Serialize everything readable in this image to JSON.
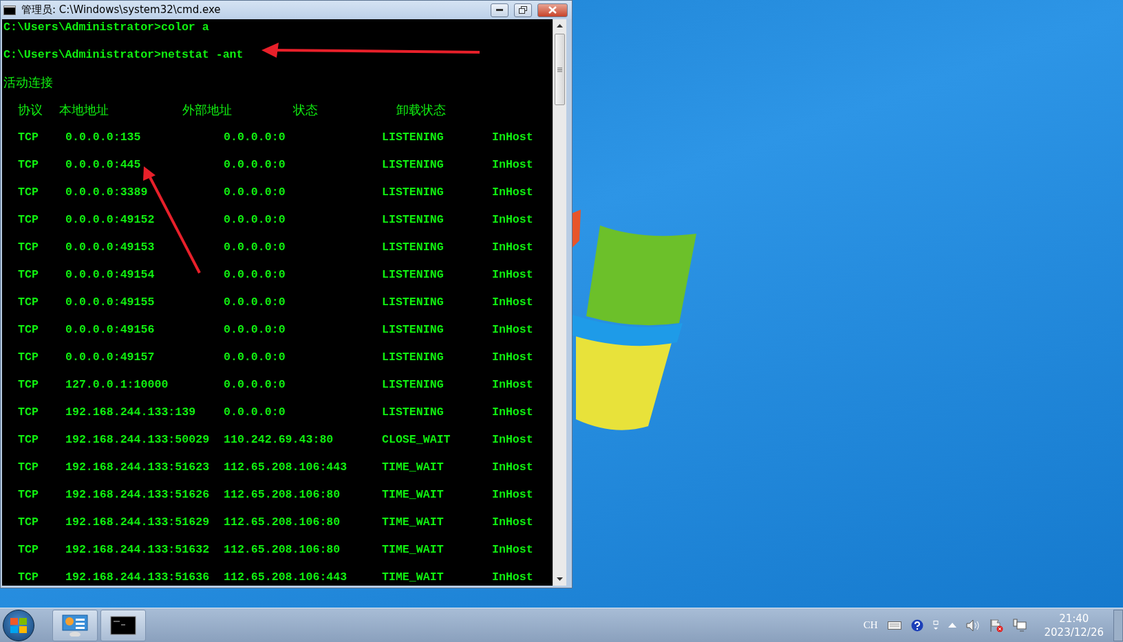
{
  "window": {
    "title": "管理员: C:\\Windows\\system32\\cmd.exe"
  },
  "console": {
    "commands": [
      "C:\\Users\\Administrator>color a",
      "C:\\Users\\Administrator>netstat -ant"
    ],
    "section_title": "活动连接",
    "columns": [
      "协议",
      "本地地址",
      "外部地址",
      "状态",
      "卸载状态"
    ],
    "rows": [
      {
        "protocol": "TCP",
        "local": "0.0.0.0:135",
        "foreign": "0.0.0.0:0",
        "state": "LISTENING",
        "offload": "InHost"
      },
      {
        "protocol": "TCP",
        "local": "0.0.0.0:445",
        "foreign": "0.0.0.0:0",
        "state": "LISTENING",
        "offload": "InHost"
      },
      {
        "protocol": "TCP",
        "local": "0.0.0.0:3389",
        "foreign": "0.0.0.0:0",
        "state": "LISTENING",
        "offload": "InHost"
      },
      {
        "protocol": "TCP",
        "local": "0.0.0.0:49152",
        "foreign": "0.0.0.0:0",
        "state": "LISTENING",
        "offload": "InHost"
      },
      {
        "protocol": "TCP",
        "local": "0.0.0.0:49153",
        "foreign": "0.0.0.0:0",
        "state": "LISTENING",
        "offload": "InHost"
      },
      {
        "protocol": "TCP",
        "local": "0.0.0.0:49154",
        "foreign": "0.0.0.0:0",
        "state": "LISTENING",
        "offload": "InHost"
      },
      {
        "protocol": "TCP",
        "local": "0.0.0.0:49155",
        "foreign": "0.0.0.0:0",
        "state": "LISTENING",
        "offload": "InHost"
      },
      {
        "protocol": "TCP",
        "local": "0.0.0.0:49156",
        "foreign": "0.0.0.0:0",
        "state": "LISTENING",
        "offload": "InHost"
      },
      {
        "protocol": "TCP",
        "local": "0.0.0.0:49157",
        "foreign": "0.0.0.0:0",
        "state": "LISTENING",
        "offload": "InHost"
      },
      {
        "protocol": "TCP",
        "local": "127.0.0.1:10000",
        "foreign": "0.0.0.0:0",
        "state": "LISTENING",
        "offload": "InHost"
      },
      {
        "protocol": "TCP",
        "local": "192.168.244.133:139",
        "foreign": "0.0.0.0:0",
        "state": "LISTENING",
        "offload": "InHost"
      },
      {
        "protocol": "TCP",
        "local": "192.168.244.133:50029",
        "foreign": "110.242.69.43:80",
        "state": "CLOSE_WAIT",
        "offload": "InHost"
      },
      {
        "protocol": "TCP",
        "local": "192.168.244.133:51623",
        "foreign": "112.65.208.106:443",
        "state": "TIME_WAIT",
        "offload": "InHost"
      },
      {
        "protocol": "TCP",
        "local": "192.168.244.133:51626",
        "foreign": "112.65.208.106:80",
        "state": "TIME_WAIT",
        "offload": "InHost"
      },
      {
        "protocol": "TCP",
        "local": "192.168.244.133:51629",
        "foreign": "112.65.208.106:80",
        "state": "TIME_WAIT",
        "offload": "InHost"
      },
      {
        "protocol": "TCP",
        "local": "192.168.244.133:51632",
        "foreign": "112.65.208.106:80",
        "state": "TIME_WAIT",
        "offload": "InHost"
      },
      {
        "protocol": "TCP",
        "local": "192.168.244.133:51636",
        "foreign": "112.65.208.106:443",
        "state": "TIME_WAIT",
        "offload": "InHost"
      }
    ]
  },
  "tray": {
    "language": "CH",
    "time": "21:40",
    "date": "2023/12/26"
  }
}
